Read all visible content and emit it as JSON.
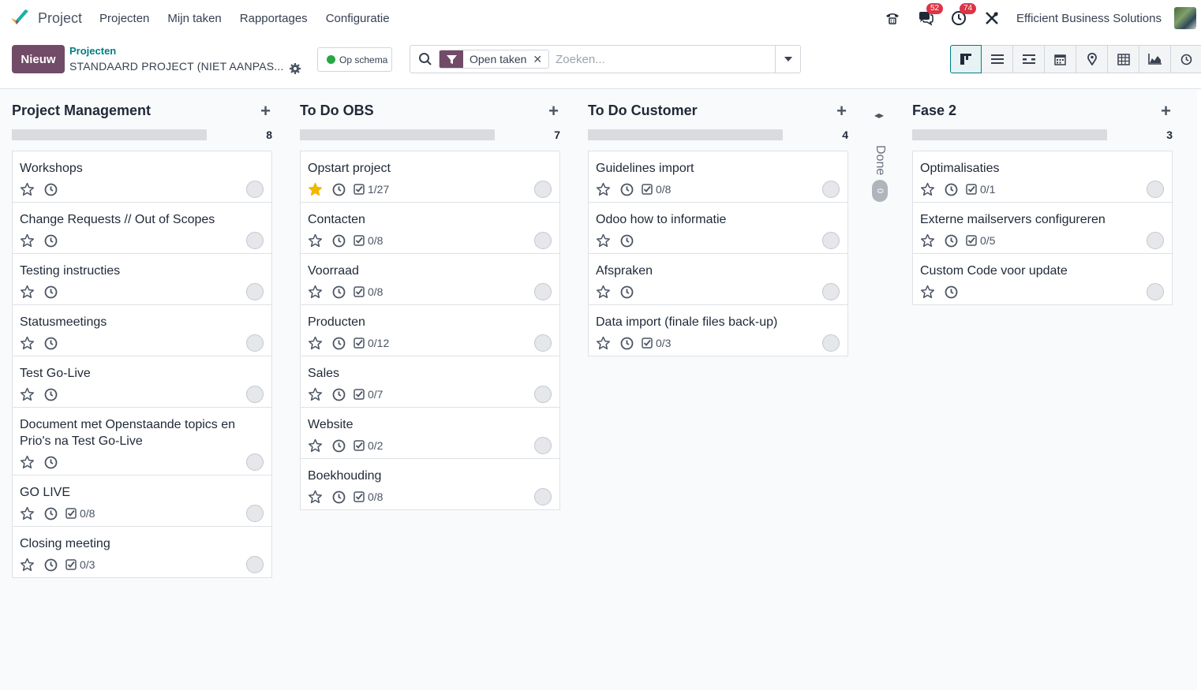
{
  "app": {
    "name": "Project"
  },
  "menu": [
    "Projecten",
    "Mijn taken",
    "Rapportages",
    "Configuratie"
  ],
  "systray": {
    "chat_count": "52",
    "activity_count": "74",
    "company": "Efficient Business Solutions"
  },
  "control": {
    "new_label": "Nieuw",
    "breadcrumb_parent": "Projecten",
    "breadcrumb_current": "STANDAARD PROJECT (NIET AANPAS...",
    "status_label": "Op schema",
    "filter_facet": "Open taken",
    "search_placeholder": "Zoeken..."
  },
  "views": [
    "kanban-icon",
    "list-icon",
    "gantt-icon",
    "calendar-icon",
    "map-icon",
    "pivot-icon",
    "graph-icon",
    "activity-icon"
  ],
  "columns": [
    {
      "title": "Project Management",
      "count": "8",
      "cards": [
        {
          "title": "Workshops",
          "checklist": ""
        },
        {
          "title": "Change Requests // Out of Scopes",
          "checklist": ""
        },
        {
          "title": "Testing instructies",
          "checklist": ""
        },
        {
          "title": "Statusmeetings",
          "checklist": ""
        },
        {
          "title": "Test Go-Live",
          "checklist": ""
        },
        {
          "title": "Document met Openstaande topics en Prio's na Test Go-Live",
          "checklist": ""
        },
        {
          "title": "GO LIVE",
          "checklist": "0/8"
        },
        {
          "title": "Closing meeting",
          "checklist": "0/3"
        }
      ]
    },
    {
      "title": "To Do OBS",
      "count": "7",
      "cards": [
        {
          "title": "Opstart project",
          "checklist": "1/27",
          "starred": true
        },
        {
          "title": "Contacten",
          "checklist": "0/8"
        },
        {
          "title": "Voorraad",
          "checklist": "0/8"
        },
        {
          "title": "Producten",
          "checklist": "0/12"
        },
        {
          "title": "Sales",
          "checklist": "0/7"
        },
        {
          "title": "Website",
          "checklist": "0/2"
        },
        {
          "title": "Boekhouding",
          "checklist": "0/8"
        }
      ]
    },
    {
      "title": "To Do Customer",
      "count": "4",
      "cards": [
        {
          "title": "Guidelines import",
          "checklist": "0/8"
        },
        {
          "title": "Odoo how to informatie",
          "checklist": ""
        },
        {
          "title": "Afspraken",
          "checklist": ""
        },
        {
          "title": "Data import (finale files back-up)",
          "checklist": "0/3"
        }
      ]
    },
    {
      "title": "Fase 2",
      "count": "3",
      "cards": [
        {
          "title": "Optimalisaties",
          "checklist": "0/1"
        },
        {
          "title": "Externe mailservers configureren",
          "checklist": "0/5"
        },
        {
          "title": "Custom Code voor update",
          "checklist": ""
        }
      ]
    }
  ],
  "folded_column": {
    "title": "Done",
    "count": "0"
  },
  "colors": {
    "brand": "#714b67",
    "link": "#017e84",
    "status_green": "#28a745",
    "star": "#f3b700",
    "badge": "#dc3545"
  }
}
